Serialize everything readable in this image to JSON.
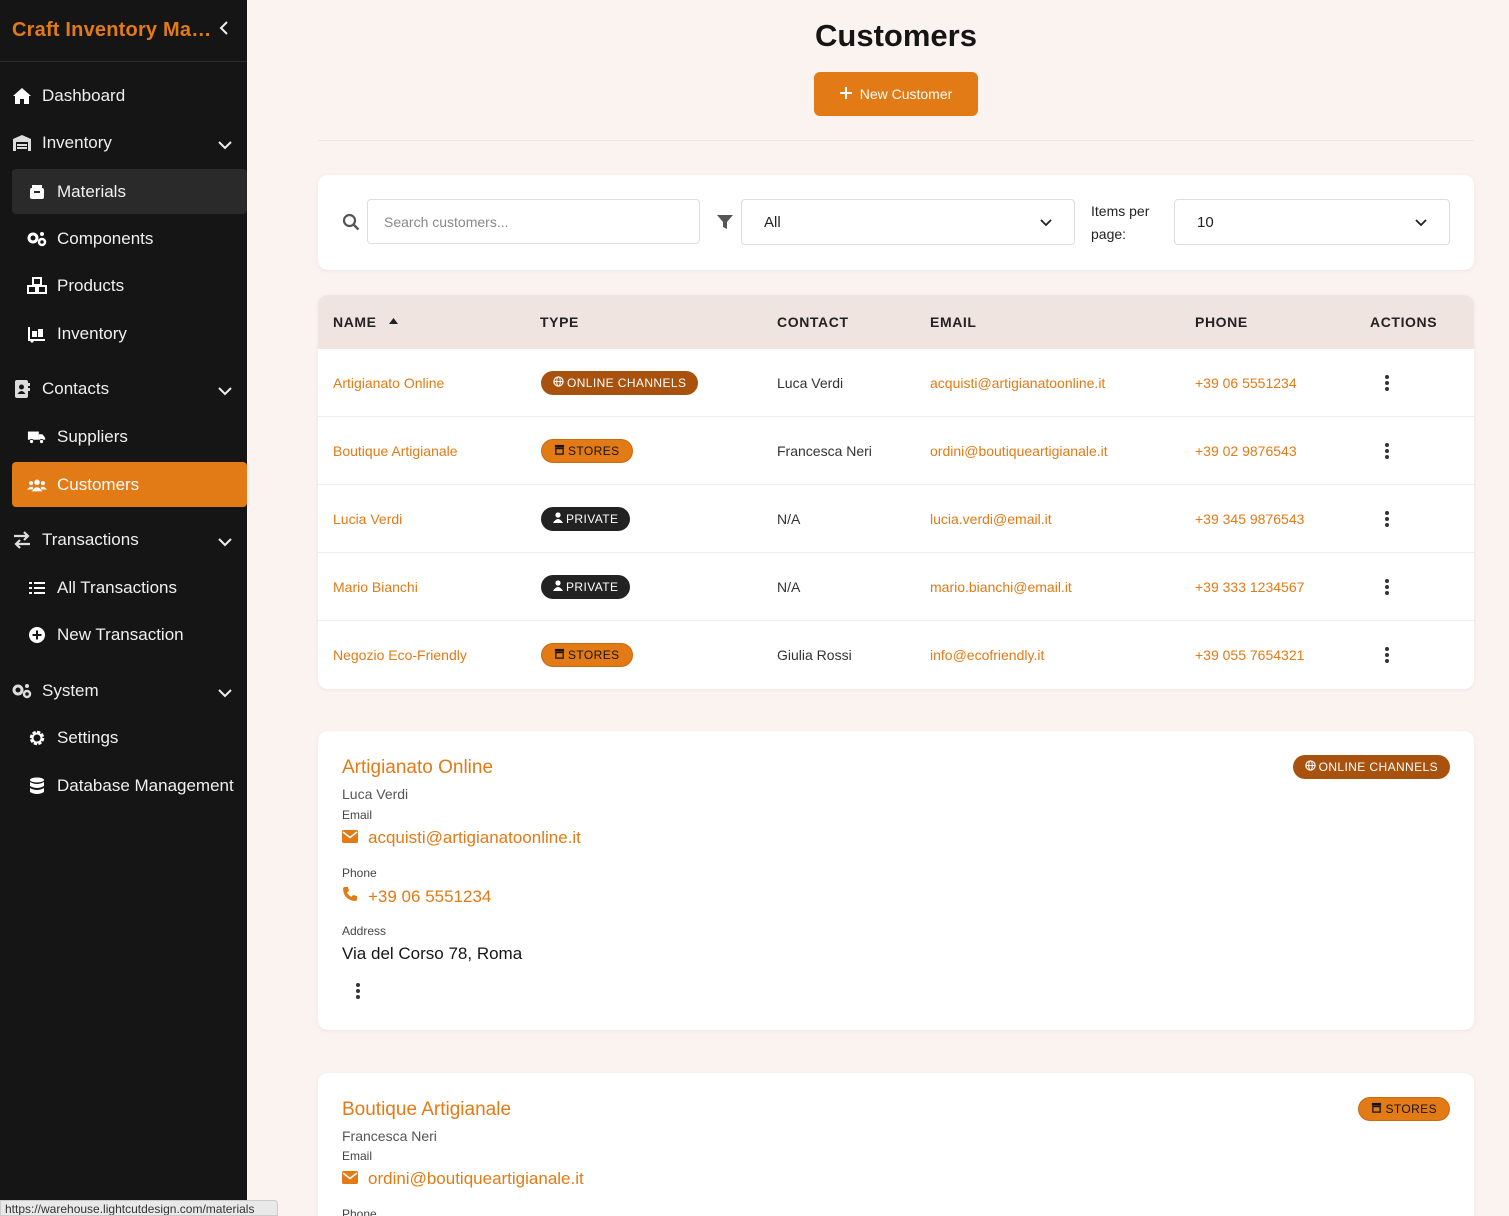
{
  "app": {
    "title": "Craft Inventory Man...",
    "collapse_icon": "chevron-left-icon"
  },
  "sidebar": {
    "dashboard": "Dashboard",
    "inventory_group": "Inventory",
    "materials": "Materials",
    "components": "Components",
    "products": "Products",
    "inventory": "Inventory",
    "contacts_group": "Contacts",
    "suppliers": "Suppliers",
    "customers": "Customers",
    "transactions_group": "Transactions",
    "all_transactions": "All Transactions",
    "new_transaction": "New Transaction",
    "system_group": "System",
    "settings": "Settings",
    "database_management": "Database Management"
  },
  "status_url": "https://warehouse.lightcutdesign.com/materials",
  "page": {
    "title": "Customers",
    "new_button": "New Customer"
  },
  "filters": {
    "search_placeholder": "Search customers...",
    "type_value": "All",
    "items_per_page_label": "Items per page:",
    "items_per_page_value": "10"
  },
  "table": {
    "headers": {
      "name": "NAME",
      "type": "TYPE",
      "contact": "CONTACT",
      "email": "EMAIL",
      "phone": "PHONE",
      "actions": "ACTIONS"
    },
    "sort": {
      "column": "name",
      "direction": "ascending"
    },
    "rows": [
      {
        "name": "Artigianato Online",
        "type": "ONLINE CHANNELS",
        "contact": "Luca Verdi",
        "email": "acquisti@artigianatoonline.it",
        "phone": "+39 06 5551234"
      },
      {
        "name": "Boutique Artigianale",
        "type": "STORES",
        "contact": "Francesca Neri",
        "email": "ordini@boutiqueartigianale.it",
        "phone": "+39 02 9876543"
      },
      {
        "name": "Lucia Verdi",
        "type": "PRIVATE",
        "contact": "N/A",
        "email": "lucia.verdi@email.it",
        "phone": "+39 345 9876543"
      },
      {
        "name": "Mario Bianchi",
        "type": "PRIVATE",
        "contact": "N/A",
        "email": "mario.bianchi@email.it",
        "phone": "+39 333 1234567"
      },
      {
        "name": "Negozio Eco-Friendly",
        "type": "STORES",
        "contact": "Giulia Rossi",
        "email": "info@ecofriendly.it",
        "phone": "+39 055 7654321"
      }
    ]
  },
  "cards": [
    {
      "name": "Artigianato Online",
      "contact": "Luca Verdi",
      "type": "ONLINE CHANNELS",
      "email_label": "Email",
      "email": "acquisti@artigianatoonline.it",
      "phone_label": "Phone",
      "phone": "+39 06 5551234",
      "address_label": "Address",
      "address": "Via del Corso 78, Roma"
    },
    {
      "name": "Boutique Artigianale",
      "contact": "Francesca Neri",
      "type": "STORES",
      "email_label": "Email",
      "email": "ordini@boutiqueartigianale.it",
      "phone_label": "Phone"
    }
  ],
  "colors": {
    "accent": "#e27a16",
    "online_badge": "#a8520d",
    "private_badge": "#222222",
    "sidebar_bg": "#151515",
    "page_bg": "#fbf3f0"
  }
}
